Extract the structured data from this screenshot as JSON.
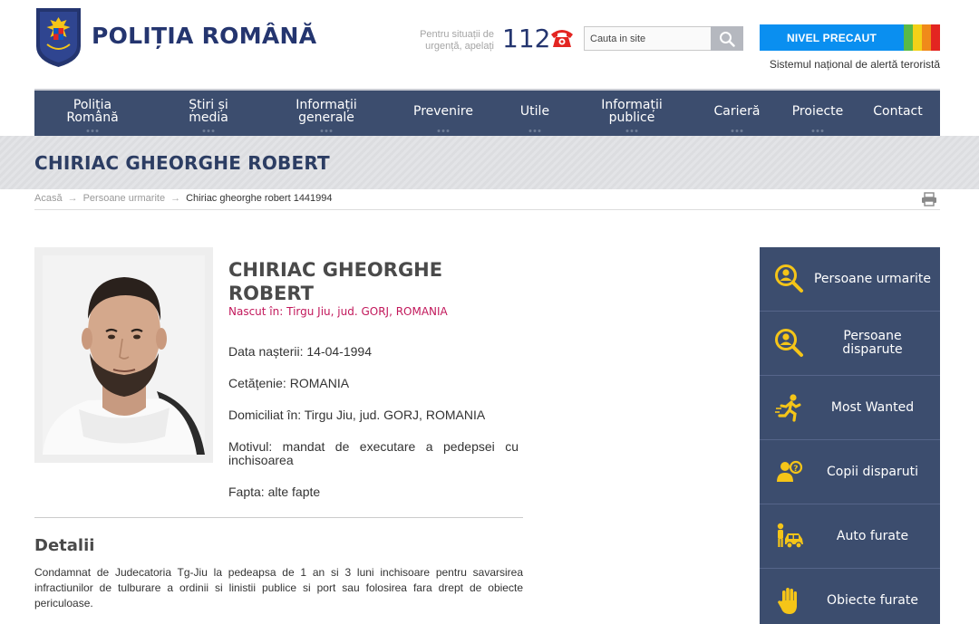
{
  "header": {
    "brand": "POLIȚIA ROMÂNĂ",
    "emergency_text": "Pentru situații de urgență, apelați",
    "emergency_number": "112",
    "search_placeholder": "Cauta in site",
    "alert_level": "NIVEL PRECAUT",
    "alert_subtitle": "Sistemul național de alertă teroristă",
    "alert_colors": [
      "#0a8ff0",
      "#59b947",
      "#f3d118",
      "#f08a1a",
      "#e32521"
    ]
  },
  "nav": {
    "items": [
      {
        "label": "Poliția Română"
      },
      {
        "label": "Știri și media"
      },
      {
        "label": "Informații generale"
      },
      {
        "label": "Prevenire"
      },
      {
        "label": "Utile"
      },
      {
        "label": "Informații publice"
      },
      {
        "label": "Carieră"
      },
      {
        "label": "Proiecte"
      },
      {
        "label": "Contact"
      }
    ]
  },
  "page": {
    "title": "CHIRIAC GHEORGHE ROBERT"
  },
  "breadcrumb": {
    "home": "Acasă",
    "section": "Persoane urmarite",
    "current": "Chiriac gheorghe robert 1441994",
    "separator": "→"
  },
  "person": {
    "name": "CHIRIAC GHEORGHE ROBERT",
    "born": "Nascut în: Tirgu Jiu, jud. GORJ, ROMANIA",
    "birth_date": "Data nașterii: 14-04-1994",
    "citizenship": "Cetățenie: ROMANIA",
    "residence": "Domiciliat în: Tirgu Jiu, jud. GORJ, ROMANIA",
    "motive": "Motivul: mandat de executare a pedepsei cu inchisoarea",
    "deed": "Fapta: alte fapte"
  },
  "details": {
    "heading": "Detalii",
    "text": "Condamnat de Judecatoria Tg-Jiu la pedeapsa de 1 an si 3 luni inchisoare pentru savarsirea infractiunilor de tulburare a ordinii si linistii publice si port sau folosirea fara drept de obiecte periculoase."
  },
  "sidebar": {
    "items": [
      {
        "label": "Persoane urmarite",
        "icon": "search-person-icon"
      },
      {
        "label": "Persoane disparute",
        "icon": "search-person-icon"
      },
      {
        "label": "Most Wanted",
        "icon": "running-person-icon"
      },
      {
        "label": "Copii disparuti",
        "icon": "child-icon"
      },
      {
        "label": "Auto furate",
        "icon": "car-thief-icon"
      },
      {
        "label": "Obiecte furate",
        "icon": "hand-icon"
      }
    ]
  },
  "colors": {
    "brand": "#24356f",
    "nav_bg": "#3c4d6e",
    "accent_yellow": "#f5c518",
    "born_text": "#c2185b"
  }
}
